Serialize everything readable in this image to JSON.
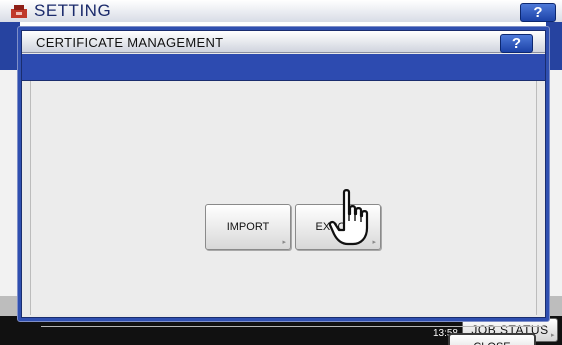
{
  "background_screen": {
    "title": "SETTING",
    "help_label": "?",
    "status_bar": {
      "date": "",
      "time": "13:58",
      "job_status_label": "JOB STATUS",
      "job_status_arrow": "▸"
    }
  },
  "dialog": {
    "title": "CERTIFICATE MANAGEMENT",
    "help_label": "?",
    "buttons": {
      "import": {
        "label": "IMPORT",
        "arrow": "▸"
      },
      "export": {
        "label": "EXPORT",
        "arrow": "▸"
      },
      "close": {
        "label": "CLOSE"
      }
    }
  },
  "cursor": {
    "icon": "hand-pointer-icon",
    "target": "export-button"
  },
  "colors": {
    "dialog_frame": "#2f4fb0",
    "help_button": "#1d43a8",
    "content_background": "#ececec",
    "status_bar": "#111111"
  }
}
